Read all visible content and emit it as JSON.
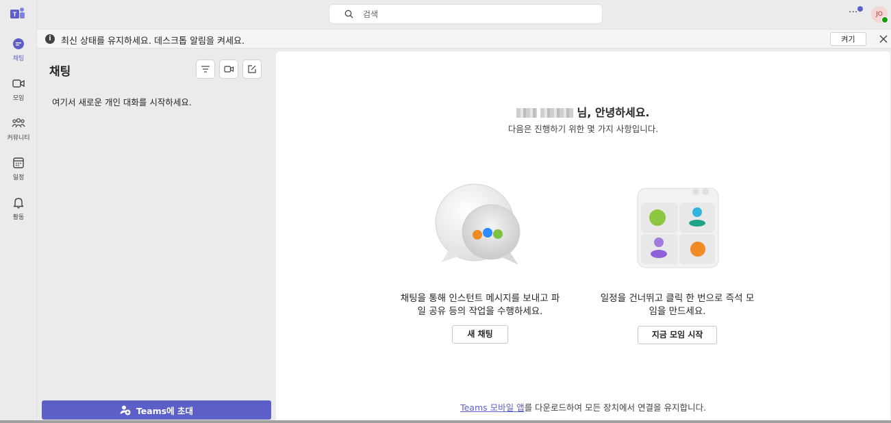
{
  "rail": {
    "items": [
      {
        "label": "채팅",
        "icon": "chat-icon",
        "active": true
      },
      {
        "label": "모임",
        "icon": "video-icon",
        "active": false
      },
      {
        "label": "커뮤니티",
        "icon": "community-icon",
        "active": false
      },
      {
        "label": "일정",
        "icon": "calendar-icon",
        "active": false
      },
      {
        "label": "활동",
        "icon": "bell-icon",
        "active": false
      }
    ]
  },
  "topbar": {
    "search_placeholder": "검색",
    "more": "···",
    "avatar_initials": "JO"
  },
  "banner": {
    "message": "최신 상태를 유지하세요. 데스크톱 알림을 켜세요.",
    "on_button": "켜기"
  },
  "pane": {
    "title": "채팅",
    "empty_message": "여기서 새로운 개인 대화를 시작하세요.",
    "invite_button": "Teams에 초대"
  },
  "main": {
    "greeting_suffix": "님, 안녕하세요.",
    "subtitle": "다음은 진행하기 위한 몇 가지 사항입니다.",
    "cards": [
      {
        "description": "채팅을 통해 인스턴트 메시지를 보내고 파일 공유 등의 작업을 수행하세요.",
        "button": "새 채팅"
      },
      {
        "description": "일정을 건너뛰고 클릭 한 번으로 즉석 모임을 만드세요.",
        "button": "지금 모임 시작"
      }
    ],
    "footer_link": "Teams 모바일 앱",
    "footer_text": "를 다운로드하여 모든 장치에서 연결을 유지합니다."
  },
  "colors": {
    "accent": "#5b5fc7",
    "presence": "#13a10e"
  }
}
